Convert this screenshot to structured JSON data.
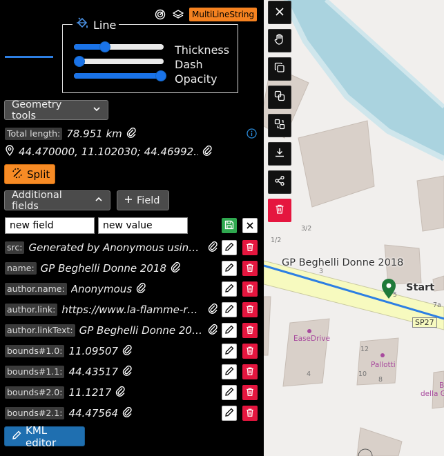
{
  "header": {
    "geometry_type": "MultiLineString",
    "icons": [
      "radar-icon",
      "layers-icon"
    ]
  },
  "line_style": {
    "legend": "Line",
    "sliders": [
      {
        "label": "Thickness",
        "value_fraction": 0.35
      },
      {
        "label": "Dash",
        "value_fraction": 0.05
      },
      {
        "label": "Opacity",
        "value_fraction": 1.0
      }
    ],
    "color": "#2d7fe3"
  },
  "geometry_tools": {
    "label": "Geometry tools"
  },
  "stats": {
    "total_length_label": "Total length:",
    "total_length_value": "78.951 km",
    "coords_value": "44.470000, 11.102030; 44.46992…"
  },
  "split": {
    "label": "Split"
  },
  "additional_fields": {
    "label": "Additional fields",
    "add_field_label": "Field"
  },
  "new_field": {
    "name_value": "new field",
    "value_value": "new value"
  },
  "fields": [
    {
      "key": "src:",
      "value": "Generated by Anonymous using …"
    },
    {
      "key": "name:",
      "value": "GP Beghelli Donne 2018"
    },
    {
      "key": "author.name:",
      "value": "Anonymous"
    },
    {
      "key": "author.link:",
      "value": "https://www.la-flamme-ro…"
    },
    {
      "key": "author.linkText:",
      "value": "GP Beghelli Donne 2018"
    },
    {
      "key": "bounds#1.0:",
      "value": "11.09507"
    },
    {
      "key": "bounds#1.1:",
      "value": "44.43517"
    },
    {
      "key": "bounds#2.0:",
      "value": "11.1217"
    },
    {
      "key": "bounds#2.1:",
      "value": "44.47564"
    }
  ],
  "kml_editor": {
    "label": "KML editor"
  },
  "toolbar": [
    "close-icon",
    "hand-icon",
    "copy-icon",
    "duplicate-icon",
    "convert-icon",
    "download-icon",
    "share-icon",
    "delete-icon"
  ],
  "map": {
    "route_label": "GP Beghelli Donne 2018",
    "start_label": "Start",
    "road_label": "SP27",
    "poi": [
      "EaseDrive",
      "Pallotti"
    ],
    "house_numbers": [
      "3/2",
      "1/2",
      "3",
      "5",
      "7a",
      "12",
      "10",
      "8",
      "4"
    ],
    "partial_label": [
      "Bo",
      "della G"
    ],
    "colors": {
      "water": "#aad3df",
      "building": "#d9d0c9",
      "road": "#f7fabf",
      "route": "#2d7fe3",
      "marker": "#1f7a3a"
    }
  }
}
